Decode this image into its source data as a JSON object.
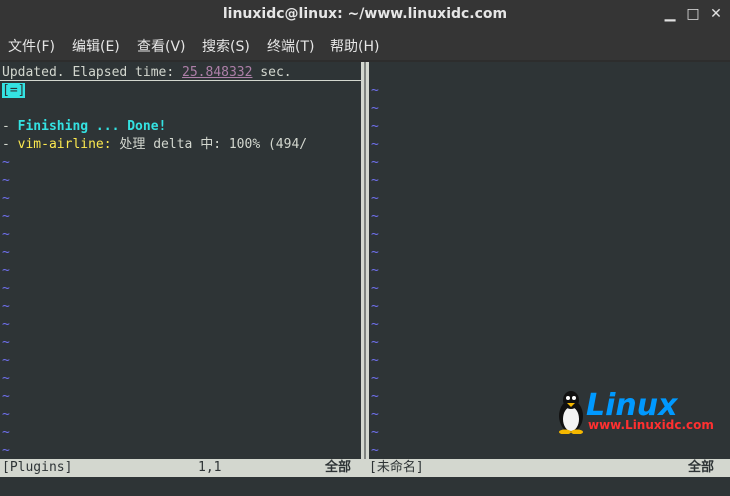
{
  "window": {
    "title": "linuxidc@linux: ~/www.linuxidc.com",
    "minimize": "▁",
    "maximize": "□",
    "close": "✕"
  },
  "menu": [
    "文件(F)",
    "编辑(E)",
    "查看(V)",
    "搜索(S)",
    "终端(T)",
    "帮助(H)"
  ],
  "editor": {
    "line1_prefix": "Updated. Elapsed time: ",
    "line1_time": "25.848332",
    "line1_suffix": " sec.",
    "line2": "[=]",
    "line4_prefix": "- ",
    "line4_text": "Finishing ... Done!",
    "line5_prefix": "- ",
    "line5_plugin": "vim-airline:",
    "line5_text": " 处理 delta 中: 100% (494/",
    "tilde": "~"
  },
  "status": {
    "buffer": "[Plugins]",
    "position": "1,1",
    "all": "全部",
    "right_buffer": "[未命名]",
    "right_all": "全部"
  },
  "watermark": {
    "brand": "Linux",
    "site": "www.Linuxidc.com"
  }
}
